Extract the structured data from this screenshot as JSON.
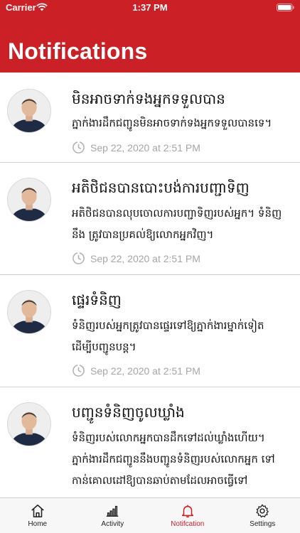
{
  "status_bar": {
    "carrier": "Carrier",
    "time": "1:37 PM"
  },
  "header": {
    "title": "Notifications",
    "color": "#cc2027"
  },
  "notifications": [
    {
      "title": "មិនអាចទាក់ទងអ្នកទទួលបាន",
      "body": "ភ្នាក់ងារដឹកជញ្ជូនមិនអាចទាក់ទងអ្នកទទួលបានទេ។",
      "time": "Sep 22, 2020 at 2:51 PM"
    },
    {
      "title": "អតិថិជនបានបោះបង់ការបញ្ជាទិញ",
      "body": "អតិថិជនបានលុបចោលការបញ្ជាទិញរបស់អ្នក។ ទំនិញនឹង ត្រូវបានប្រគល់ឱ្យលោកអ្នកវិញ។",
      "time": "Sep 22, 2020 at 2:51 PM"
    },
    {
      "title": "ផ្ទេរទំនិញ",
      "body": "ទំនិញរបស់អ្នកត្រូវបានផ្ទេរទៅឱ្យភ្នាក់ងារម្នាក់ទៀត ដើម្បីបញ្ជូនបន្ត។",
      "time": "Sep 22, 2020 at 2:51 PM"
    },
    {
      "title": "បញ្ជូនទំនិញចូលឃ្លាំង",
      "body": "ទំនិញរបស់លោកអ្នកបានដឹកទៅដល់ឃ្លាំងហើយ។ ភ្នាក់ងារដឹកជញ្ជូននឹងបញ្ជូនទំនិញរបស់លោកអ្នក ទៅកាន់គោលដៅឱ្យបានឆាប់តាមដែលអាចធ្វើទៅ",
      "time": ""
    }
  ],
  "tabs": [
    {
      "label": "Home",
      "icon": "home-icon"
    },
    {
      "label": "Activity",
      "icon": "activity-icon"
    },
    {
      "label": "Notifcation",
      "icon": "bell-icon",
      "active": true
    },
    {
      "label": "Settings",
      "icon": "gear-icon"
    }
  ]
}
